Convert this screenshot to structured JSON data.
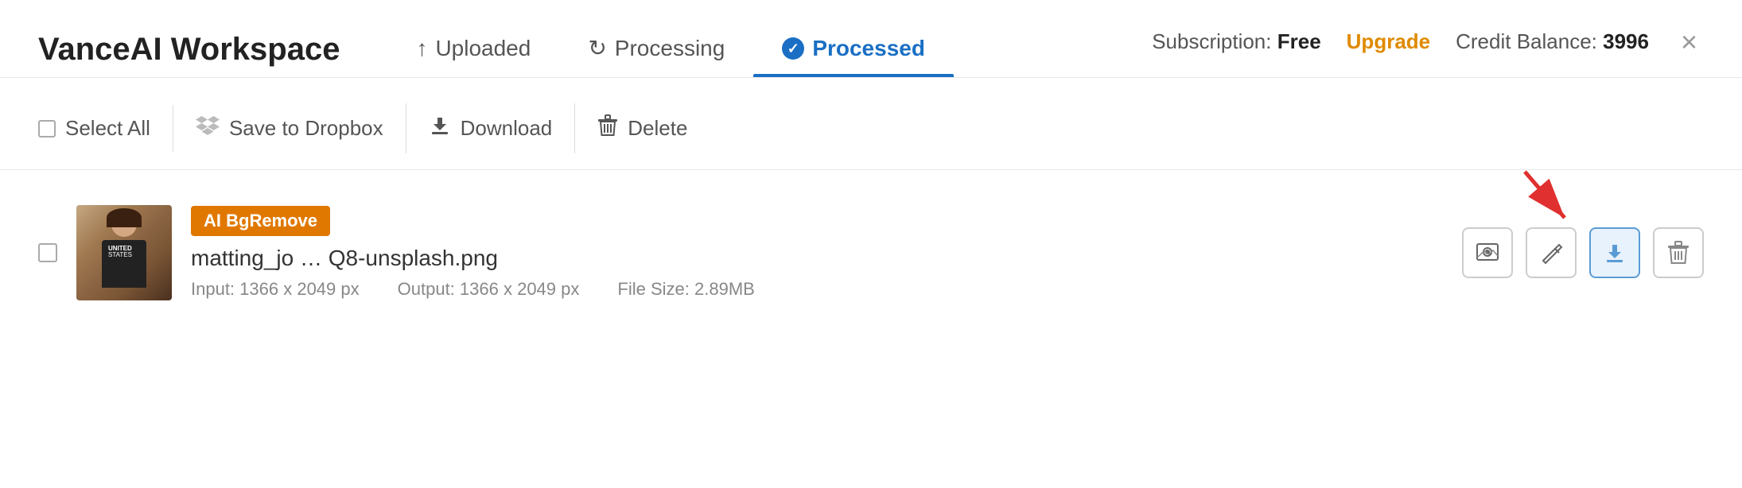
{
  "app": {
    "title": "VanceAI Workspace"
  },
  "header": {
    "tabs": [
      {
        "id": "uploaded",
        "label": "Uploaded",
        "icon": "↑",
        "active": false
      },
      {
        "id": "processing",
        "label": "Processing",
        "icon": "↻",
        "active": false
      },
      {
        "id": "processed",
        "label": "Processed",
        "icon": "✓",
        "active": true
      }
    ],
    "subscription_label": "Subscription:",
    "subscription_plan": "Free",
    "upgrade_label": "Upgrade",
    "credit_label": "Credit Balance:",
    "credit_value": "3996"
  },
  "toolbar": {
    "select_all_label": "Select All",
    "save_dropbox_label": "Save to Dropbox",
    "download_label": "Download",
    "delete_label": "Delete"
  },
  "files": [
    {
      "id": "1",
      "badge": "AI BgRemove",
      "name": "matting_jo … Q8-unsplash.png",
      "input_size": "1366 x 2049 px",
      "output_size": "1366 x 2049 px",
      "file_size": "2.89MB"
    }
  ],
  "file_meta": {
    "input_label": "Input:",
    "output_label": "Output:",
    "file_size_label": "File Size:"
  },
  "actions": {
    "preview_title": "Preview",
    "edit_title": "Edit",
    "download_title": "Download",
    "delete_title": "Delete"
  },
  "colors": {
    "active_tab": "#1a6fc4",
    "upgrade": "#e08a00",
    "badge_bg": "#e07800",
    "download_active": "#5b9bd5"
  }
}
